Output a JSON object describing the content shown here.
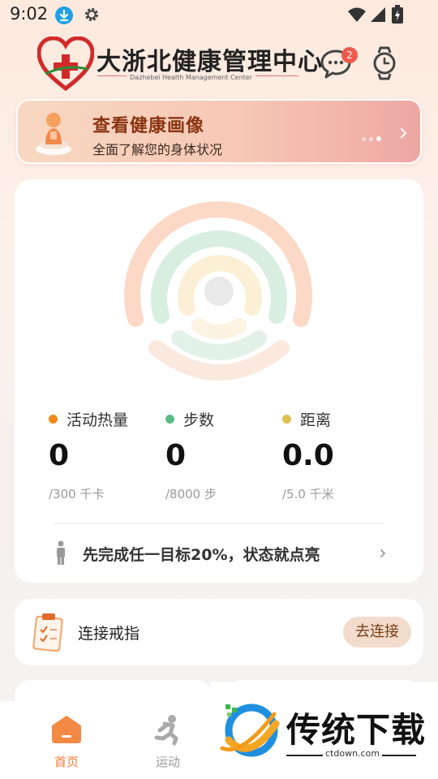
{
  "status_bar": {
    "time": "9:02",
    "icons": [
      "download-icon",
      "gear-icon",
      "wifi-icon",
      "signal-icon",
      "battery-icon"
    ]
  },
  "header": {
    "logo_title": "大浙北健康管理中心",
    "logo_subtitle": "Dazhebei Health Management Center",
    "message_badge": "2",
    "icons": [
      "chat-icon",
      "smartwatch-icon"
    ]
  },
  "banner": {
    "title": "查看健康画像",
    "subtitle": "全面了解您的身体状况"
  },
  "activity": {
    "ring_colors": {
      "calories": "#f28a46",
      "steps": "#6cc08b",
      "distance": "#e8c44a"
    },
    "metrics": [
      {
        "label": "活动热量",
        "value": "0",
        "goal": "/300 千卡",
        "color": "#f28a18"
      },
      {
        "label": "步数",
        "value": "0",
        "goal": "/8000 步",
        "color": "#5dbb86"
      },
      {
        "label": "距离",
        "value": "0.0",
        "goal": "/5.0 千米",
        "color": "#e0c050"
      }
    ],
    "tip": "先完成任一目标20%，状态就点亮"
  },
  "connect": {
    "label": "连接戒指",
    "button": "去连接"
  },
  "bottom_nav": {
    "items": [
      {
        "label": "首页",
        "active": true,
        "icon": "home-icon"
      },
      {
        "label": "运动",
        "active": false,
        "icon": "running-icon"
      }
    ],
    "accent": "#f07a3a"
  },
  "watermark": {
    "text": "传统下载",
    "url": "ctdown.com"
  }
}
